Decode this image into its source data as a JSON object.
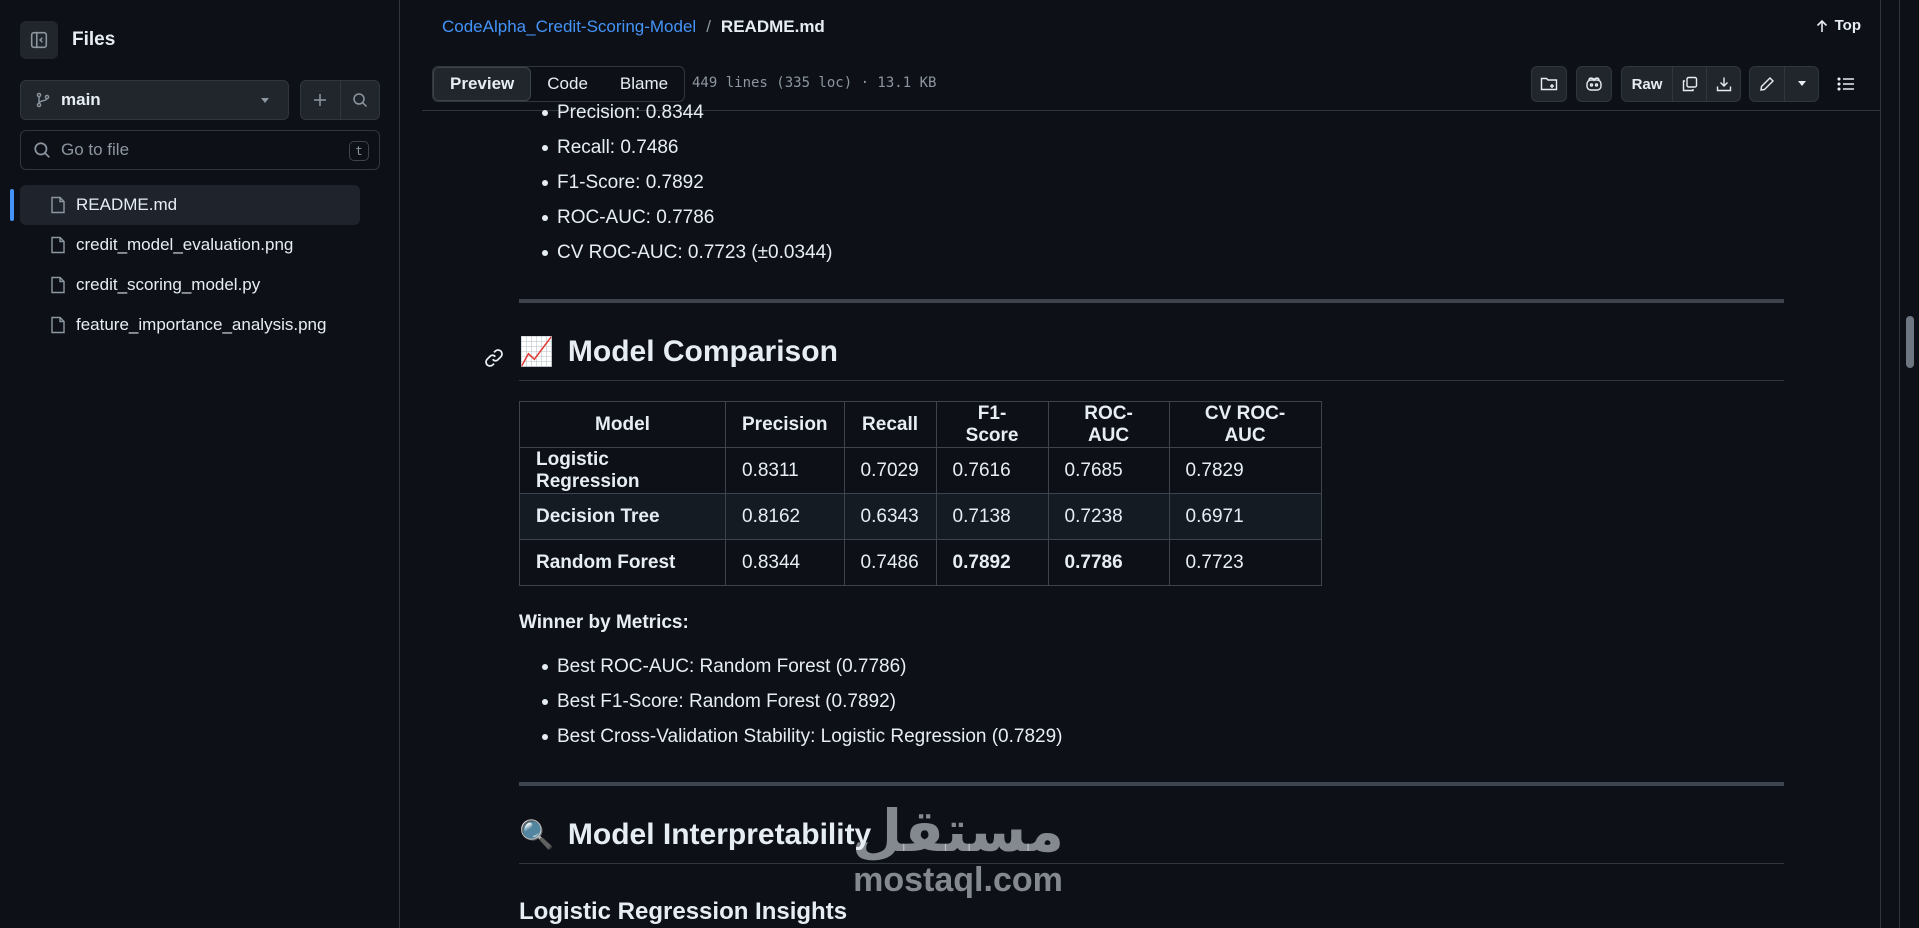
{
  "sidebar": {
    "title": "Files",
    "branch": "main",
    "goto_placeholder": "Go to file",
    "goto_shortcut": "t",
    "files": [
      {
        "name": "README.md",
        "active": true
      },
      {
        "name": "credit_model_evaluation.png",
        "active": false
      },
      {
        "name": "credit_scoring_model.py",
        "active": false
      },
      {
        "name": "feature_importance_analysis.png",
        "active": false
      }
    ]
  },
  "header": {
    "repo": "CodeAlpha_Credit-Scoring-Model",
    "separator": "/",
    "file": "README.md",
    "top_label": "Top",
    "tabs": [
      "Preview",
      "Code",
      "Blame"
    ],
    "meta": "449 lines (335 loc) · 13.1 KB",
    "raw_label": "Raw"
  },
  "readme": {
    "top_metrics": [
      "Precision: 0.8344",
      "Recall: 0.7486",
      "F1-Score: 0.7892",
      "ROC-AUC: 0.7786",
      "CV ROC-AUC: 0.7723 (±0.0344)"
    ],
    "comparison": {
      "emoji": "📈",
      "heading": "Model Comparison",
      "columns": [
        "Model",
        "Precision",
        "Recall",
        "F1-Score",
        "ROC-AUC",
        "CV ROC-AUC"
      ],
      "rows": [
        [
          "Logistic Regression",
          "0.8311",
          "0.7029",
          "0.7616",
          "0.7685",
          "0.7829"
        ],
        [
          "Decision Tree",
          "0.8162",
          "0.6343",
          "0.7138",
          "0.7238",
          "0.6971"
        ],
        [
          "Random Forest",
          "0.8344",
          "0.7486",
          "0.7892",
          "0.7786",
          "0.7723"
        ]
      ],
      "winner_label": "Winner by Metrics:",
      "winners": [
        "Best ROC-AUC: Random Forest (0.7786)",
        "Best F1-Score: Random Forest (0.7892)",
        "Best Cross-Validation Stability: Logistic Regression (0.7829)"
      ]
    },
    "interpretability": {
      "emoji": "🔍",
      "heading": "Model Interpretability",
      "subheading": "Logistic Regression Insights"
    }
  },
  "watermark": {
    "arabic": "مستقل",
    "latin": "mostaql.com"
  },
  "colors": {
    "background": "#0d1117",
    "link": "#4493f8",
    "border": "#30363d",
    "text": "#e6edf3",
    "muted": "#8d96a0"
  }
}
